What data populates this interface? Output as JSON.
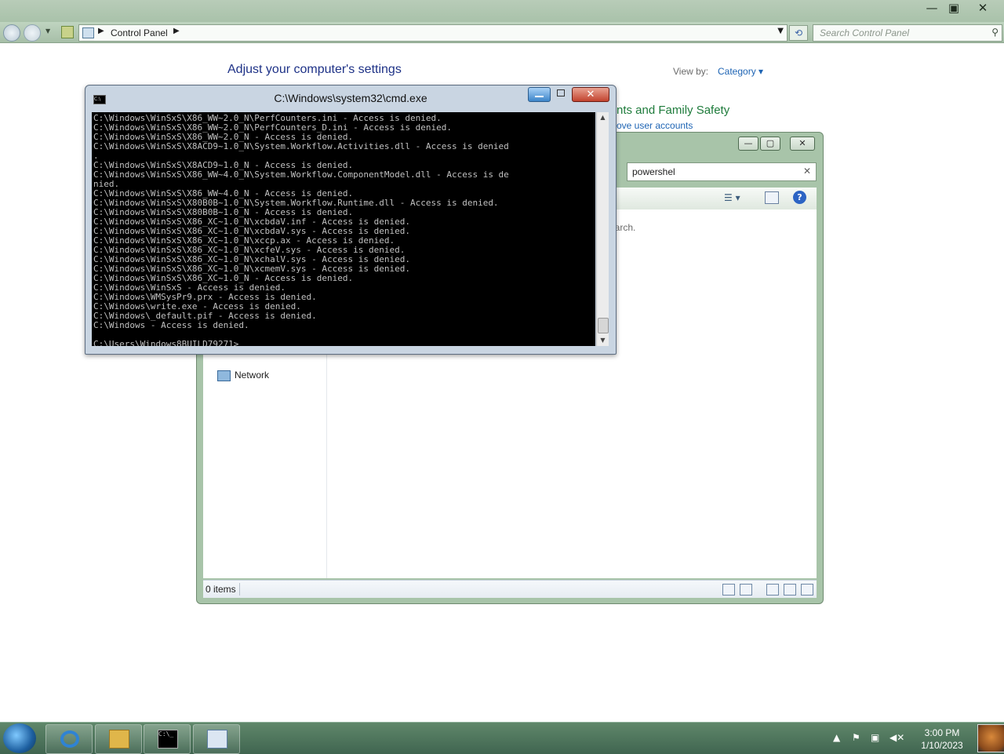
{
  "control_panel": {
    "window_buttons": {
      "minimize": "—",
      "maximize": "▣",
      "close": "✕"
    },
    "address_label": "Control Panel",
    "search_placeholder": "Search Control Panel",
    "heading": "Adjust your computer's settings",
    "view_by_label": "View by:",
    "view_by_value": "Category ▾",
    "family_safety_partial": "nts and Family Safety",
    "remove_accounts_partial": "ove user accounts"
  },
  "explorer": {
    "search_value": "powershel",
    "hint_partial": "earch.",
    "nav_items": [
      {
        "label": "Network",
        "icon": "network-icon"
      }
    ],
    "status_count": "0 items"
  },
  "cmd": {
    "title": "C:\\Windows\\system32\\cmd.exe",
    "lines": [
      "C:\\Windows\\WinSxS\\X86_WW~2.0_N\\PerfCounters.ini - Access is denied.",
      "C:\\Windows\\WinSxS\\X86_WW~2.0_N\\PerfCounters_D.ini - Access is denied.",
      "C:\\Windows\\WinSxS\\X86_WW~2.0_N - Access is denied.",
      "C:\\Windows\\WinSxS\\X8ACD9~1.0_N\\System.Workflow.Activities.dll - Access is denied",
      ".",
      "C:\\Windows\\WinSxS\\X8ACD9~1.0_N - Access is denied.",
      "C:\\Windows\\WinSxS\\X86_WW~4.0_N\\System.Workflow.ComponentModel.dll - Access is de",
      "nied.",
      "C:\\Windows\\WinSxS\\X86_WW~4.0_N - Access is denied.",
      "C:\\Windows\\WinSxS\\X80B0B~1.0_N\\System.Workflow.Runtime.dll - Access is denied.",
      "C:\\Windows\\WinSxS\\X80B0B~1.0_N - Access is denied.",
      "C:\\Windows\\WinSxS\\X86_XC~1.0_N\\xcbdaV.inf - Access is denied.",
      "C:\\Windows\\WinSxS\\X86_XC~1.0_N\\xcbdaV.sys - Access is denied.",
      "C:\\Windows\\WinSxS\\X86_XC~1.0_N\\xccp.ax - Access is denied.",
      "C:\\Windows\\WinSxS\\X86_XC~1.0_N\\xcfeV.sys - Access is denied.",
      "C:\\Windows\\WinSxS\\X86_XC~1.0_N\\xchalV.sys - Access is denied.",
      "C:\\Windows\\WinSxS\\X86_XC~1.0_N\\xcmemV.sys - Access is denied.",
      "C:\\Windows\\WinSxS\\X86_XC~1.0_N - Access is denied.",
      "C:\\Windows\\WinSxS - Access is denied.",
      "C:\\Windows\\WMSysPr9.prx - Access is denied.",
      "C:\\Windows\\write.exe - Access is denied.",
      "C:\\Windows\\_default.pif - Access is denied.",
      "C:\\Windows - Access is denied.",
      "",
      "C:\\Users\\Windows8BUILD79271>_"
    ]
  },
  "taskbar": {
    "items": [
      {
        "name": "taskbar-ie",
        "icon": "internet-explorer-icon"
      },
      {
        "name": "taskbar-explorer",
        "icon": "folder-icon"
      },
      {
        "name": "taskbar-cmd",
        "icon": "command-prompt-icon"
      },
      {
        "name": "taskbar-control-panel",
        "icon": "control-panel-icon"
      }
    ],
    "clock_time": "3:00 PM",
    "clock_date": "1/10/2023"
  }
}
